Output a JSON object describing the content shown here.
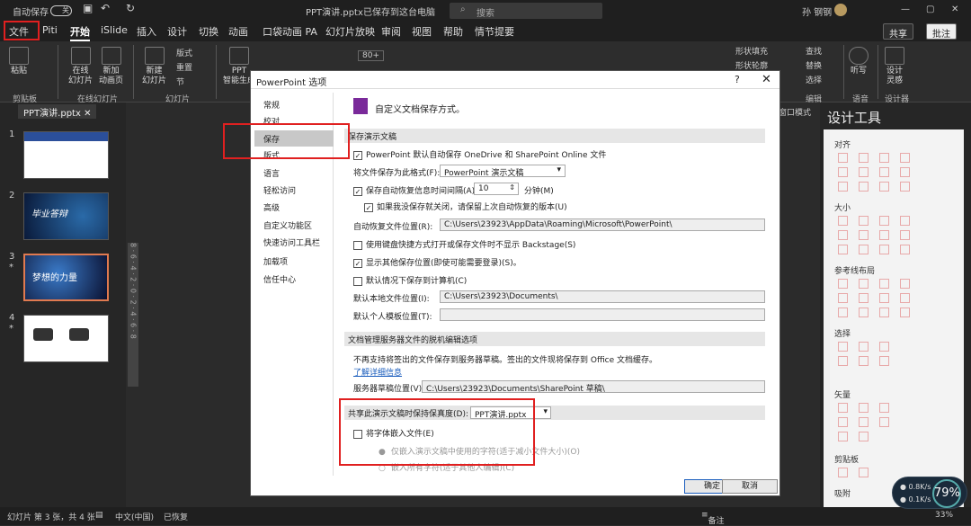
{
  "titlebar": {
    "autosave_label": "自动保存",
    "toggle_state": "关",
    "doc_title": "PPT演讲.pptx",
    "save_status": "已保存到这台电脑",
    "search_placeholder": "搜索",
    "user": "孙 钢钢"
  },
  "tabs": [
    "文件",
    "Piti",
    "开始",
    "iSlide",
    "插入",
    "设计",
    "切换",
    "动画",
    "口袋动画 PA",
    "幻灯片放映",
    "审阅",
    "视图",
    "帮助",
    "情节提要"
  ],
  "active_tab": "开始",
  "share_label": "共享",
  "comment_label": "批注",
  "ribbon": {
    "paste": "粘贴",
    "clipboard_group": "剪贴板",
    "online_slides": "在线\n幻灯片",
    "new_anim": "新加\n动画页",
    "online_group": "在线幻灯片",
    "new_slide": "新建\n幻灯片",
    "layout": "版式",
    "reset": "重置",
    "section": "节",
    "slides_group": "幻灯片",
    "ppt_smart": "PPT\n智能生成",
    "font_size": "80+",
    "shape_fill": "形状填充",
    "shape_outline": "形状轮廓",
    "find": "查找",
    "replace": "替换",
    "select": "选择",
    "edit_group": "编辑",
    "voice": "听写",
    "voice_group": "语音",
    "designer": "设计\n灵感",
    "designer_group": "设计器"
  },
  "doc_tab": "PPT演讲.pptx",
  "slides": [
    {
      "num": "1",
      "star": ""
    },
    {
      "num": "2",
      "star": ""
    },
    {
      "num": "3",
      "star": "*"
    },
    {
      "num": "4",
      "star": "*"
    }
  ],
  "slide_texts": {
    "s2": "毕业答辩",
    "s3": "梦想的力量"
  },
  "ruler_text": "8 · 6 · 4 · 2 · 0 · 2 · 4 · 6 · 8",
  "design_pane": {
    "title": "设计工具",
    "sections": [
      "对齐",
      "大小",
      "参考线布局",
      "选择",
      "矢量",
      "剪贴板",
      "吸附"
    ],
    "window_mode": "窗口模式"
  },
  "dialog": {
    "title": "PowerPoint 选项",
    "nav": [
      "常规",
      "校对",
      "保存",
      "版式",
      "语言",
      "轻松访问",
      "高级",
      "自定义功能区",
      "快速访问工具栏",
      "加载项",
      "信任中心"
    ],
    "selected_nav": "保存",
    "header": "自定义文档保存方式。",
    "sec_save": "保存演示文稿",
    "autosave_onedrive": "PowerPoint 默认自动保存 OneDrive 和 SharePoint Online 文件",
    "format_label": "将文件保存为此格式(F):",
    "format_value": "PowerPoint 演示文稿",
    "autorecover_label": "保存自动恢复信息时间间隔(A)",
    "interval": "10",
    "minutes": "分钟(M)",
    "keep_last": "如果我没保存就关闭，请保留上次自动恢复的版本(U)",
    "autorecover_loc_label": "自动恢复文件位置(R):",
    "autorecover_loc": "C:\\Users\\23923\\AppData\\Roaming\\Microsoft\\PowerPoint\\",
    "no_backstage": "使用键盘快捷方式打开或保存文件时不显示 Backstage(S)",
    "show_more": "显示其他保存位置(即使可能需要登录)(S)。",
    "save_to_pc": "默认情况下保存到计算机(C)",
    "default_local_label": "默认本地文件位置(I):",
    "default_local": "C:\\Users\\23923\\Documents\\",
    "template_label": "默认个人模板位置(T):",
    "template_value": "",
    "sec_offline": "文档管理服务器文件的脱机编辑选项",
    "offline_note": "不再支持将签出的文件保存到服务器草稿。签出的文件现将保存到 Office 文档缓存。",
    "learn_more": "了解详细信息",
    "drafts_label": "服务器草稿位置(V):",
    "drafts_value": "C:\\Users\\23923\\Documents\\SharePoint 草稿\\",
    "sec_fidelity": "共享此演示文稿时保持保真度(D):",
    "fidelity_file": "PPT演讲.pptx",
    "embed_fonts": "将字体嵌入文件(E)",
    "embed_used": "仅嵌入演示文稿中使用的字符(适于减小文件大小)(O)",
    "embed_all": "嵌入所有字符(适于其他人编辑)(C)",
    "ok": "确定",
    "cancel": "取消"
  },
  "status": {
    "slide_info": "幻灯片 第 3 张，共 4 张",
    "language": "中文(中国)",
    "recovered": "已恢复",
    "notes": "备注",
    "zoom": "33%"
  },
  "net": {
    "up": "0.8",
    "down": "0.1",
    "unit": "K/s",
    "pct": "79%"
  }
}
